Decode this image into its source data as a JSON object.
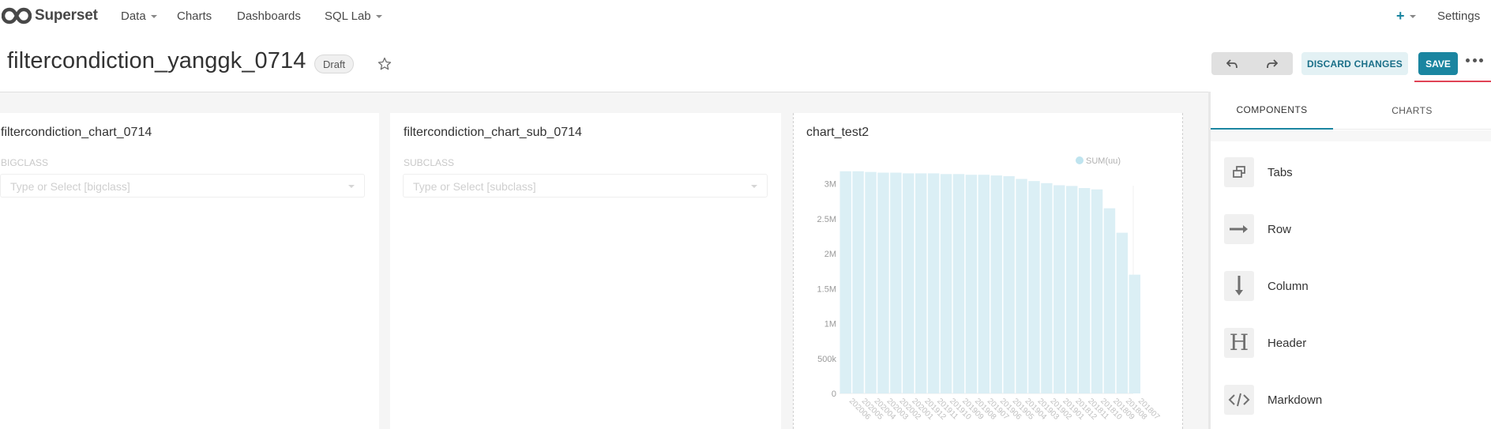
{
  "nav": {
    "brand": "Superset",
    "items": [
      {
        "label": "Data",
        "has_caret": true
      },
      {
        "label": "Charts",
        "has_caret": false
      },
      {
        "label": "Dashboards",
        "has_caret": false
      },
      {
        "label": "SQL Lab",
        "has_caret": true
      }
    ],
    "plus_icon": "plus-icon",
    "settings_label": "Settings"
  },
  "header": {
    "title": "filtercondiction_yanggk_0714",
    "badge": "Draft",
    "star_icon": "star-icon",
    "undo_icon": "undo-icon",
    "redo_icon": "redo-icon",
    "discard_label": "DISCARD CHANGES",
    "save_label": "SAVE",
    "more_icon": "more-icon"
  },
  "charts": [
    {
      "title": "filtercondiction_chart_0714",
      "filter_label": "BIGCLASS",
      "filter_placeholder": "Type or Select [bigclass]"
    },
    {
      "title": "filtercondiction_chart_sub_0714",
      "filter_label": "SUBCLASS",
      "filter_placeholder": "Type or Select [subclass]"
    },
    {
      "title": "chart_test2"
    }
  ],
  "side_panel": {
    "tabs": [
      {
        "label": "COMPONENTS",
        "active": true
      },
      {
        "label": "CHARTS",
        "active": false
      }
    ],
    "components": [
      {
        "label": "Tabs",
        "icon": "tabs-icon"
      },
      {
        "label": "Row",
        "icon": "row-arrow-icon"
      },
      {
        "label": "Column",
        "icon": "column-arrow-icon"
      },
      {
        "label": "Header",
        "icon": "header-icon"
      },
      {
        "label": "Markdown",
        "icon": "markdown-code-icon"
      }
    ]
  },
  "colors": {
    "accent": "#1a85a0",
    "bar": "#dbeff5",
    "underline": "#e04355"
  },
  "chart_data": {
    "type": "bar",
    "title": "chart_test2",
    "legend": [
      "SUM(uu)"
    ],
    "legend_position": "top-right",
    "ytick_labels": [
      "0",
      "500k",
      "1M",
      "1.5M",
      "2M",
      "2.5M",
      "3M"
    ],
    "ylim": [
      0,
      3200000
    ],
    "categories": [
      "202006",
      "202005",
      "202004",
      "202003",
      "202002",
      "202001",
      "201912",
      "201911",
      "201910",
      "201909",
      "201908",
      "201907",
      "201906",
      "201905",
      "201904",
      "201903",
      "201902",
      "201901",
      "201812",
      "201811",
      "201810",
      "201809",
      "201808",
      "201807"
    ],
    "series": [
      {
        "name": "SUM(uu)",
        "values": [
          3180000,
          3180000,
          3170000,
          3160000,
          3160000,
          3150000,
          3150000,
          3150000,
          3140000,
          3140000,
          3130000,
          3130000,
          3120000,
          3110000,
          3070000,
          3040000,
          3010000,
          2980000,
          2970000,
          2940000,
          2920000,
          2650000,
          2300000,
          1700000
        ]
      }
    ]
  }
}
